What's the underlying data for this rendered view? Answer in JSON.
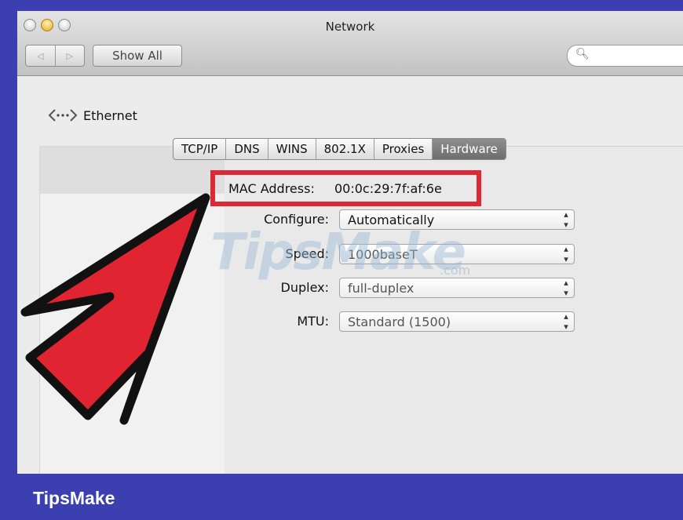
{
  "window": {
    "title": "Network"
  },
  "toolbar": {
    "back": "◁",
    "forward": "▷",
    "show_all": "Show All",
    "search_placeholder": ""
  },
  "interface": {
    "name": "Ethernet",
    "icon": "ethernet-icon"
  },
  "tabs": [
    {
      "label": "TCP/IP",
      "active": false
    },
    {
      "label": "DNS",
      "active": false
    },
    {
      "label": "WINS",
      "active": false
    },
    {
      "label": "802.1X",
      "active": false
    },
    {
      "label": "Proxies",
      "active": false
    },
    {
      "label": "Hardware",
      "active": true
    }
  ],
  "hardware": {
    "mac_label": "MAC Address:",
    "mac_value": "00:0c:29:7f:af:6e",
    "configure_label": "Configure:",
    "configure_value": "Automatically",
    "speed_label": "Speed:",
    "speed_value": "1000baseT",
    "duplex_label": "Duplex:",
    "duplex_value": "full-duplex",
    "mtu_label": "MTU:",
    "mtu_value": "Standard  (1500)"
  },
  "watermark": {
    "text": "TipsMake",
    "suffix": ".com"
  },
  "brand": {
    "text": "TipsMake"
  },
  "colors": {
    "frame": "#3b3fb0",
    "highlight": "#dd2836",
    "arrow": "#e02431"
  }
}
